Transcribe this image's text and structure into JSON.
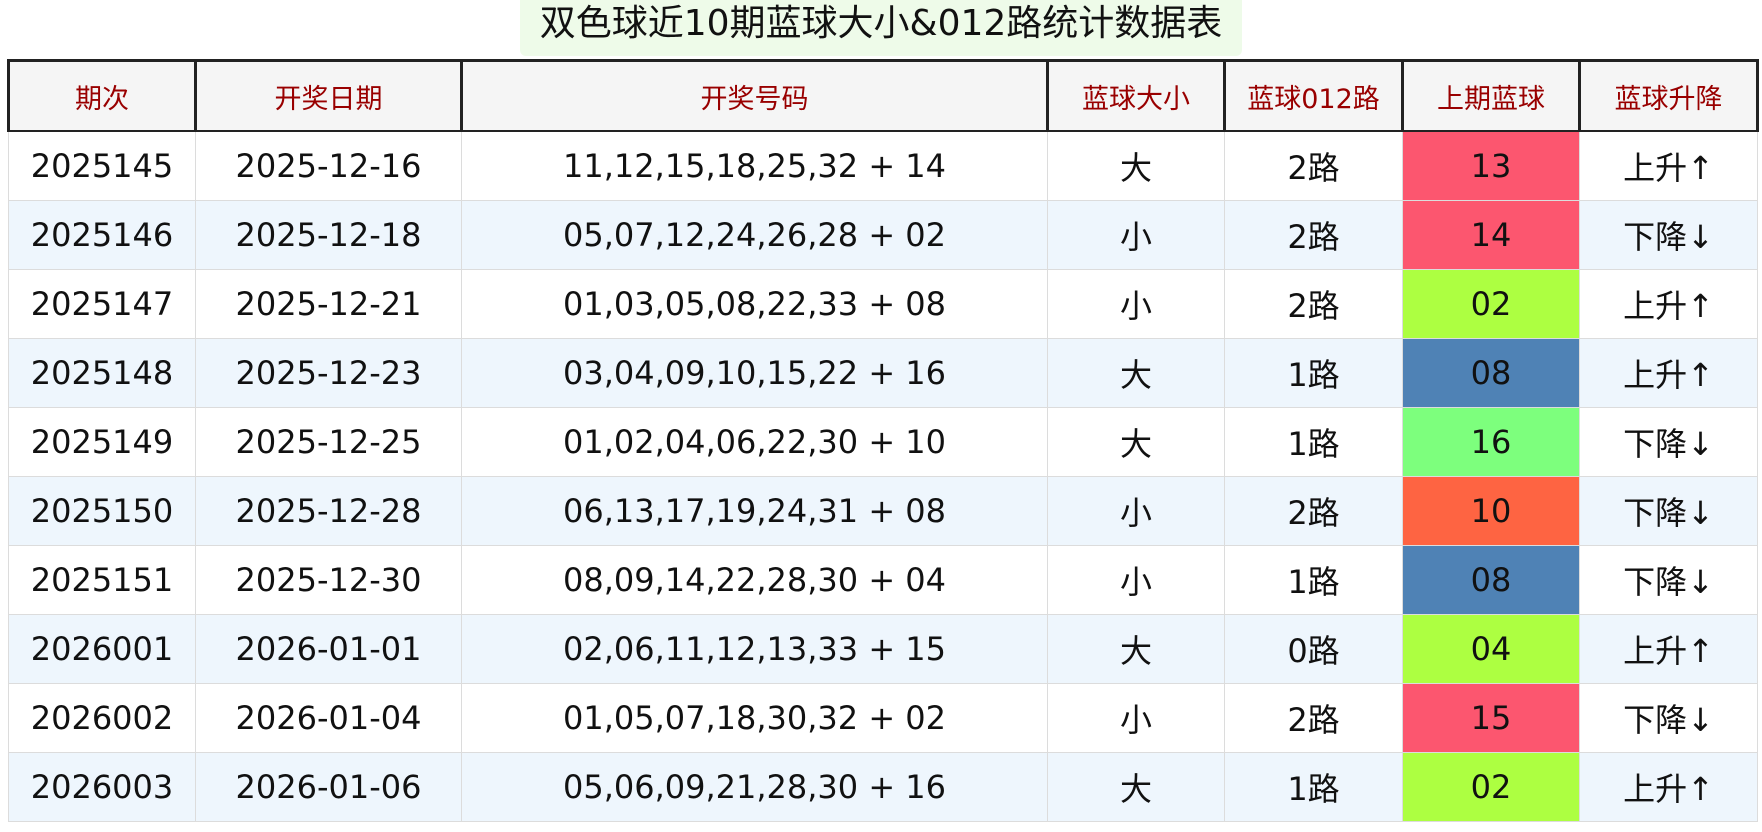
{
  "title": "双色球近10期蓝球大小&012路统计数据表",
  "headers": [
    "期次",
    "开奖日期",
    "开奖号码",
    "蓝球大小",
    "蓝球012路",
    "上期蓝球",
    "蓝球升降"
  ],
  "colors": {
    "header_text": "#990000",
    "up": "#ee1111",
    "down": "#118811",
    "alt_row": "#eef6fd",
    "title_bg": "#eefbe9"
  },
  "rows": [
    {
      "issue": "2025145",
      "date": "2025-12-16",
      "numbers": "11,12,15,18,25,32 + 14",
      "size": "大",
      "route": "2路",
      "prev_blue": "13",
      "prev_color": "#fc566f",
      "trend": "上升↑",
      "dir": "up"
    },
    {
      "issue": "2025146",
      "date": "2025-12-18",
      "numbers": "05,07,12,24,26,28 + 02",
      "size": "小",
      "route": "2路",
      "prev_blue": "14",
      "prev_color": "#fc566f",
      "trend": "下降↓",
      "dir": "down"
    },
    {
      "issue": "2025147",
      "date": "2025-12-21",
      "numbers": "01,03,05,08,22,33 + 08",
      "size": "小",
      "route": "2路",
      "prev_blue": "02",
      "prev_color": "#adff41",
      "trend": "上升↑",
      "dir": "up"
    },
    {
      "issue": "2025148",
      "date": "2025-12-23",
      "numbers": "03,04,09,10,15,22 + 16",
      "size": "大",
      "route": "1路",
      "prev_blue": "08",
      "prev_color": "#4f82b5",
      "trend": "上升↑",
      "dir": "up"
    },
    {
      "issue": "2025149",
      "date": "2025-12-25",
      "numbers": "01,02,04,06,22,30 + 10",
      "size": "大",
      "route": "1路",
      "prev_blue": "16",
      "prev_color": "#7dff7d",
      "trend": "下降↓",
      "dir": "down"
    },
    {
      "issue": "2025150",
      "date": "2025-12-28",
      "numbers": "06,13,17,19,24,31 + 08",
      "size": "小",
      "route": "2路",
      "prev_blue": "10",
      "prev_color": "#fe6442",
      "trend": "下降↓",
      "dir": "down"
    },
    {
      "issue": "2025151",
      "date": "2025-12-30",
      "numbers": "08,09,14,22,28,30 + 04",
      "size": "小",
      "route": "1路",
      "prev_blue": "08",
      "prev_color": "#4f82b5",
      "trend": "下降↓",
      "dir": "down"
    },
    {
      "issue": "2026001",
      "date": "2026-01-01",
      "numbers": "02,06,11,12,13,33 + 15",
      "size": "大",
      "route": "0路",
      "prev_blue": "04",
      "prev_color": "#adff41",
      "trend": "上升↑",
      "dir": "up"
    },
    {
      "issue": "2026002",
      "date": "2026-01-04",
      "numbers": "01,05,07,18,30,32 + 02",
      "size": "小",
      "route": "2路",
      "prev_blue": "15",
      "prev_color": "#fc566f",
      "trend": "下降↓",
      "dir": "down"
    },
    {
      "issue": "2026003",
      "date": "2026-01-06",
      "numbers": "05,06,09,21,28,30 + 16",
      "size": "大",
      "route": "1路",
      "prev_blue": "02",
      "prev_color": "#adff41",
      "trend": "上升↑",
      "dir": "up"
    }
  ]
}
